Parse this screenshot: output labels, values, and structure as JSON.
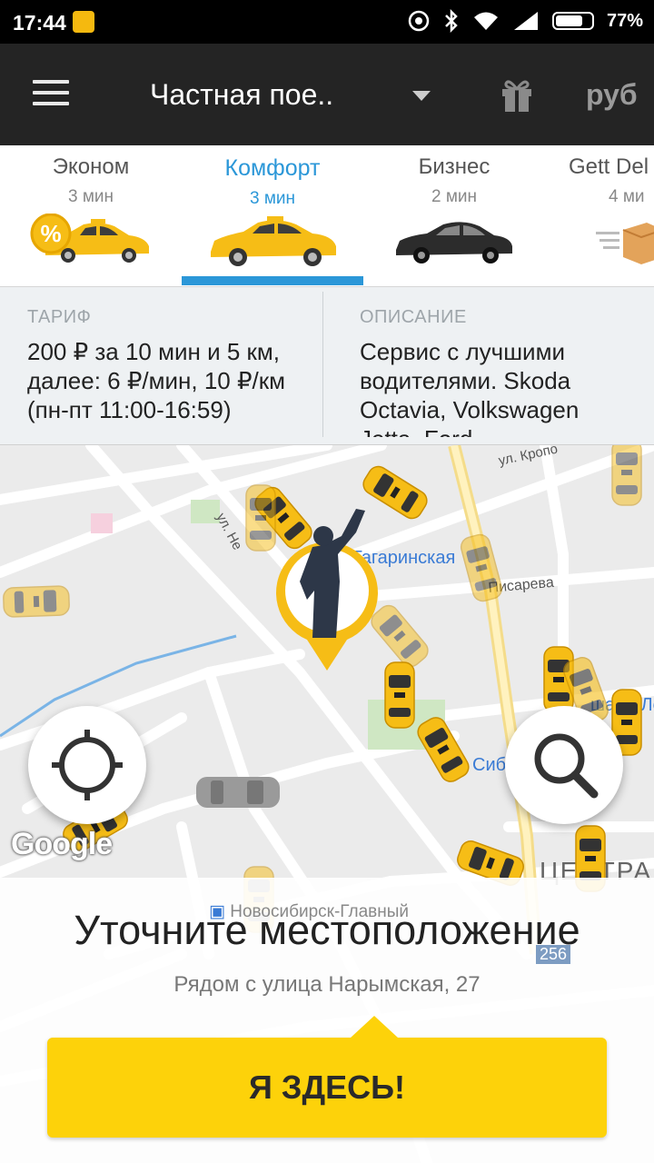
{
  "status_bar": {
    "time": "17:44",
    "battery": "77%",
    "battery_level": 0.77
  },
  "header": {
    "title": "Частная пое..",
    "currency": "руб"
  },
  "tabs": [
    {
      "name": "Эконом",
      "eta": "3 мин",
      "badge": "%"
    },
    {
      "name": "Комфорт",
      "eta": "3 мин",
      "active": true
    },
    {
      "name": "Бизнес",
      "eta": "2 мин"
    },
    {
      "name": "Gett Del",
      "eta": "4 ми"
    }
  ],
  "info": {
    "tariff_label": "ТАРИФ",
    "tariff_text": "200 ₽ за 10 мин и 5 км, далее: 6 ₽/мин, 10 ₽/км (пн-пт 11:00-16:59)",
    "description_label": "ОПИСАНИЕ",
    "description_text": "Сервис с лучшими водителями. Skoda Octavia, Volkswagen Jetta, Ford"
  },
  "map": {
    "labels": {
      "street_kropotkina": "ул. Кропо",
      "gagarinskaya": "Гагаринская",
      "pisareva": "Писарева",
      "street_nemirovicha": "ул. Не",
      "shkola": "шала Ле",
      "sibir": "Сибир",
      "centr": "ЦЕНТРА",
      "station": "Новосибирск-Главный",
      "road_number": "256"
    },
    "google": "Google"
  },
  "bottom_sheet": {
    "title": "Уточните местоположение",
    "subtitle": "Рядом с улица Нарымская, 27",
    "confirm_button": "Я ЗДЕСЬ!"
  },
  "colors": {
    "accent_blue": "#2b97d8",
    "taxi_yellow": "#f6bd16",
    "button_yellow": "#fdd20a",
    "toolbar": "#242424"
  }
}
